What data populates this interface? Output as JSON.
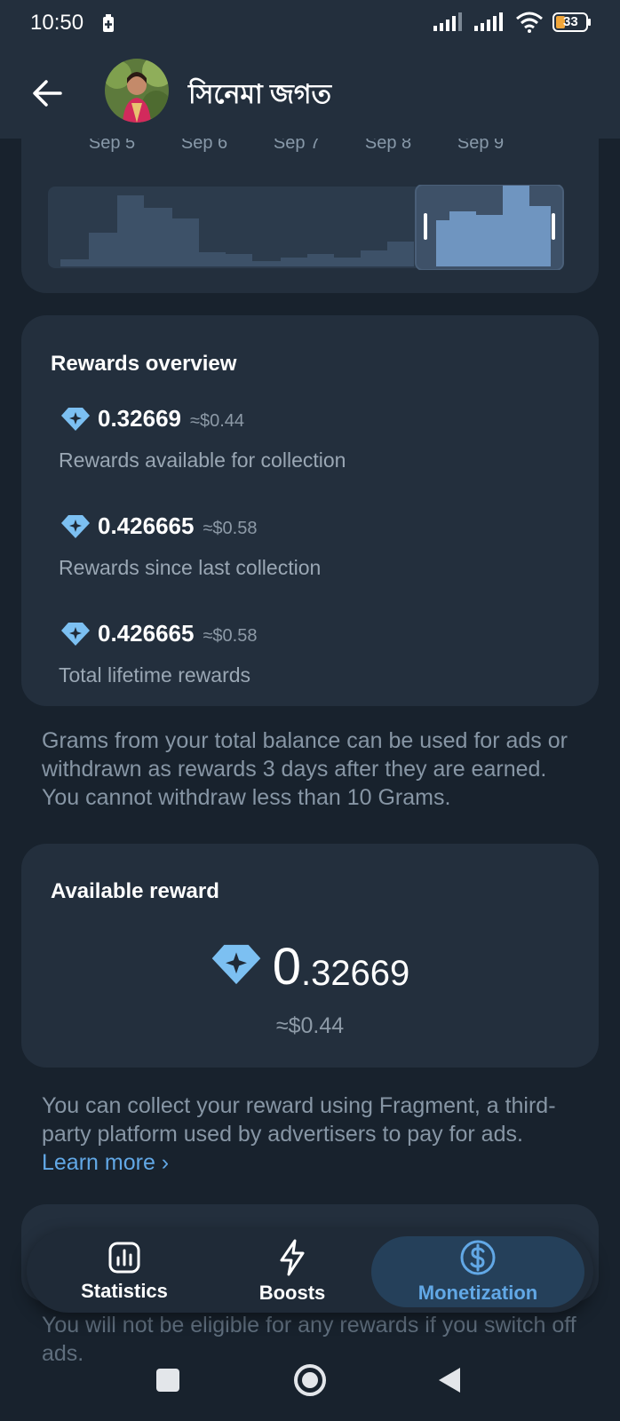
{
  "status_bar": {
    "time": "10:50",
    "battery": "33"
  },
  "header": {
    "title": "সিনেমা জগত"
  },
  "chart": {
    "dates": [
      "Sep 5",
      "Sep 6",
      "Sep 7",
      "Sep 8",
      "Sep 9"
    ]
  },
  "rewards_overview": {
    "title": "Rewards overview",
    "items": [
      {
        "amount": "0.32669",
        "usd": "≈$0.44",
        "caption": "Rewards available for collection"
      },
      {
        "amount": "0.426665",
        "usd": "≈$0.58",
        "caption": "Rewards since last collection"
      },
      {
        "amount": "0.426665",
        "usd": "≈$0.58",
        "caption": "Total lifetime rewards"
      }
    ]
  },
  "balance_note": "Grams from your total balance can be used for ads or withdrawn as rewards 3 days after they are earned. You cannot withdraw less than 10 Grams.",
  "available_reward": {
    "title": "Available reward",
    "amount_int": "0",
    "amount_frac": ".32669",
    "usd": "≈$0.44"
  },
  "fragment_note": {
    "text": "You can collect your reward using Fragment, a third-party platform used by advertisers to pay for ads.",
    "link": "Learn more"
  },
  "ads_note": "You will not be eligible for any rewards if you switch off ads.",
  "bottom_nav": {
    "items": [
      {
        "label": "Statistics",
        "icon": "bar-chart-icon",
        "active": false
      },
      {
        "label": "Boosts",
        "icon": "lightning-icon",
        "active": false
      },
      {
        "label": "Monetization",
        "icon": "dollar-icon",
        "active": true
      }
    ]
  },
  "colors": {
    "background": "#18222d",
    "card": "#232f3d",
    "accent": "#62a8e6",
    "diamond": "#7cc0f2"
  }
}
